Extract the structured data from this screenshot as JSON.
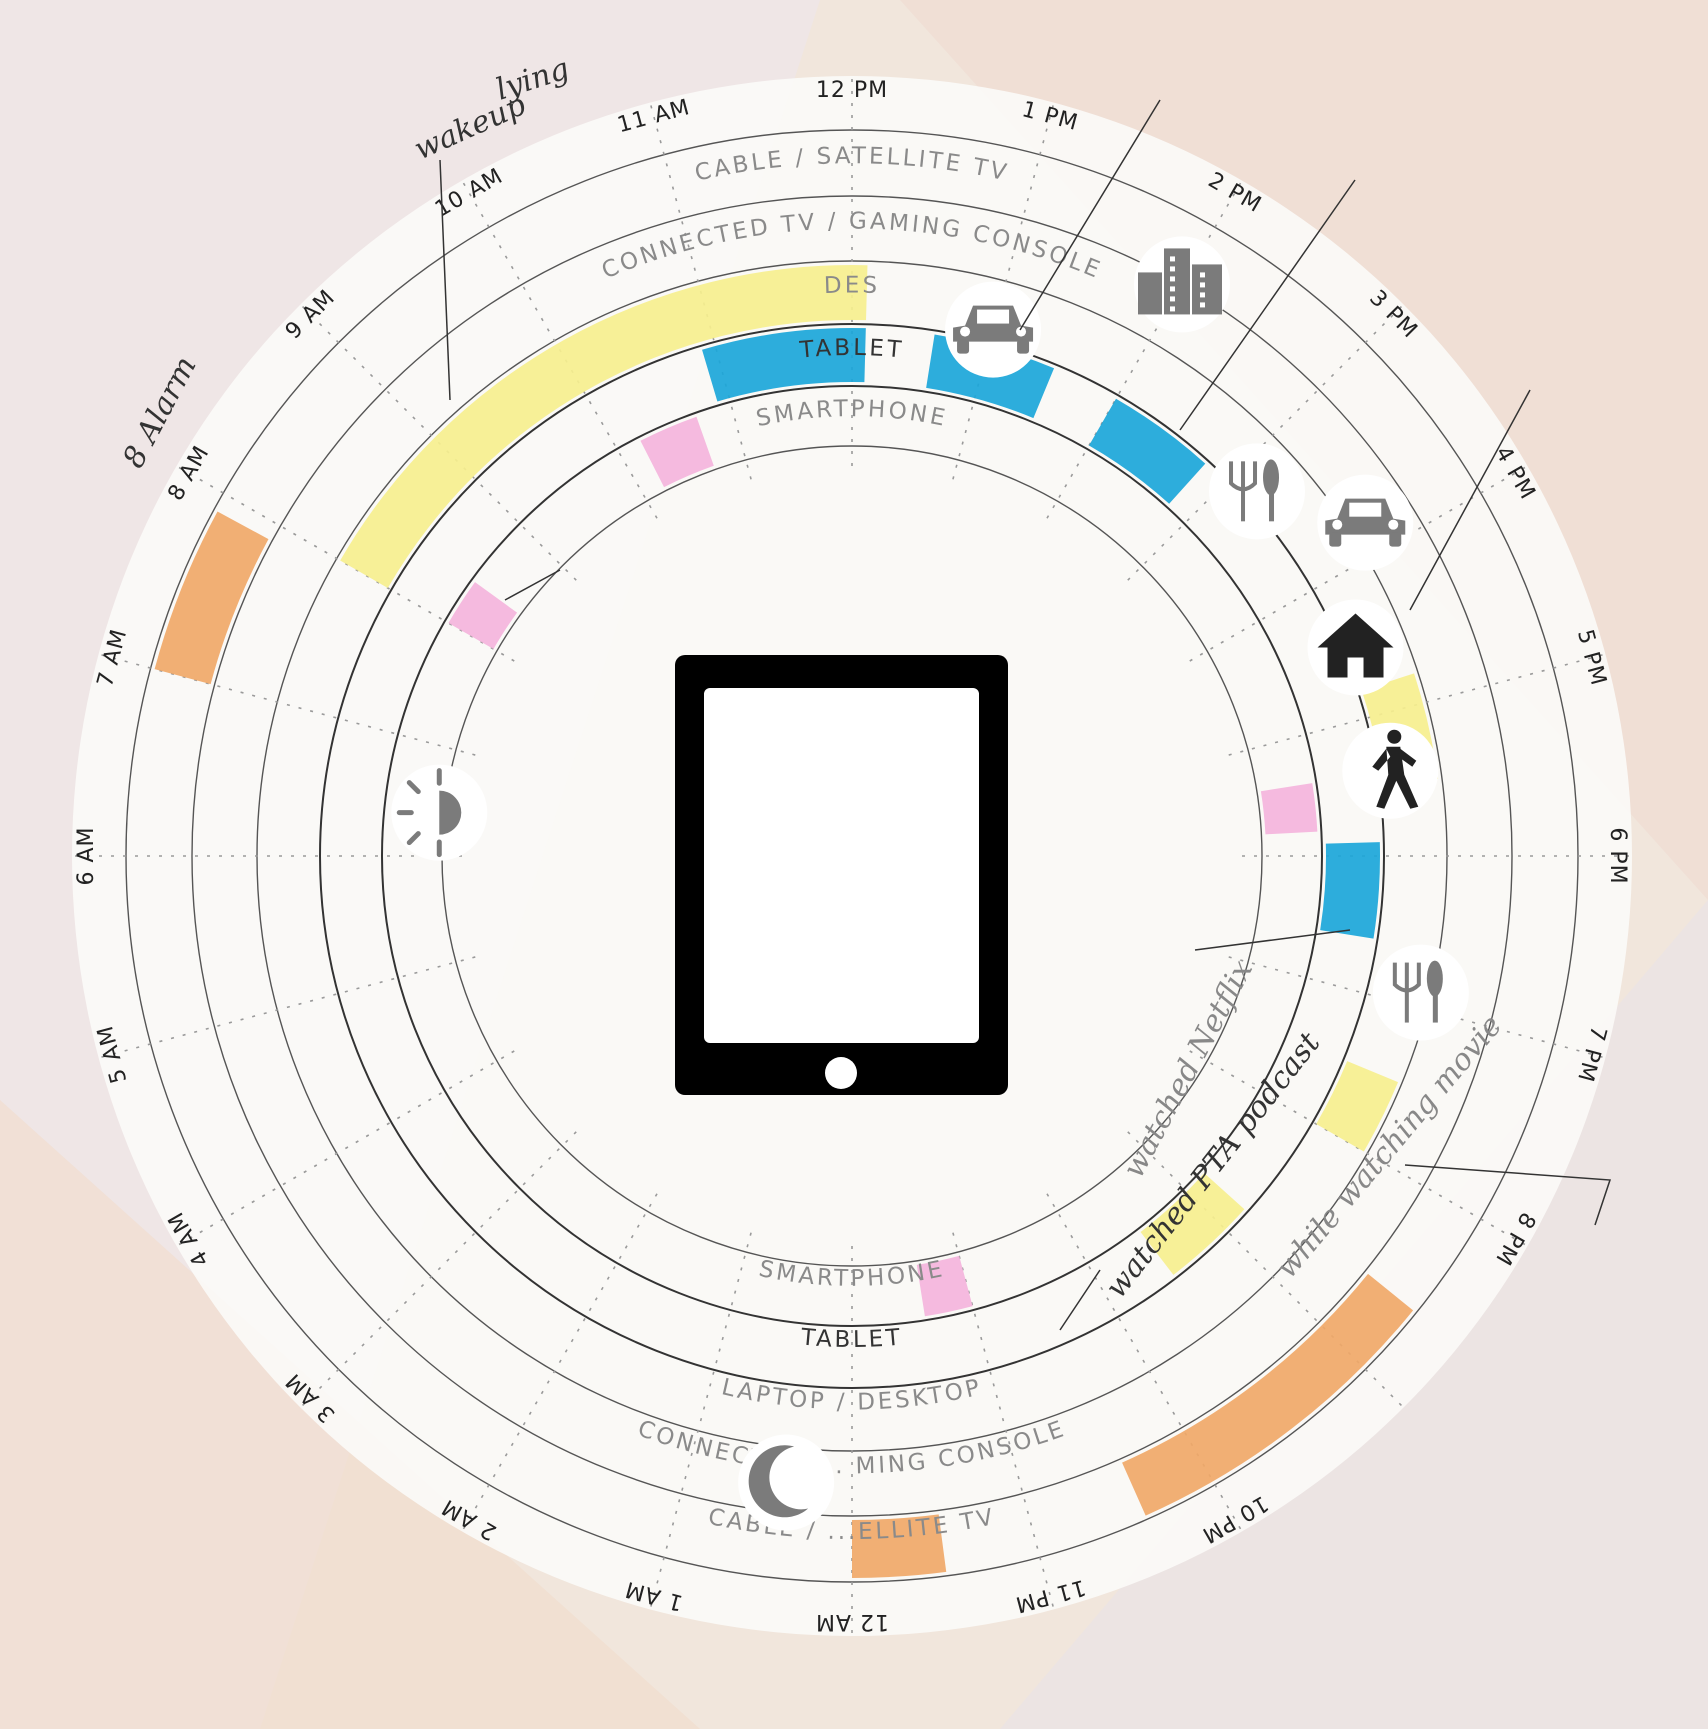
{
  "hour_labels": [
    {
      "text": "12 AM",
      "hour": 0
    },
    {
      "text": "1 AM",
      "hour": 1
    },
    {
      "text": "2 AM",
      "hour": 2
    },
    {
      "text": "3 AM",
      "hour": 3
    },
    {
      "text": "4 AM",
      "hour": 4
    },
    {
      "text": "5 AM",
      "hour": 5
    },
    {
      "text": "6 AM",
      "hour": 6
    },
    {
      "text": "7 AM",
      "hour": 7
    },
    {
      "text": "8 AM",
      "hour": 8
    },
    {
      "text": "9 AM",
      "hour": 9
    },
    {
      "text": "10 AM",
      "hour": 10
    },
    {
      "text": "11 AM",
      "hour": 11
    },
    {
      "text": "12 PM",
      "hour": 12
    },
    {
      "text": "1 PM",
      "hour": 13
    },
    {
      "text": "2 PM",
      "hour": 14
    },
    {
      "text": "3 PM",
      "hour": 15
    },
    {
      "text": "4 PM",
      "hour": 16
    },
    {
      "text": "5 PM",
      "hour": 17
    },
    {
      "text": "6 PM",
      "hour": 18
    },
    {
      "text": "7 PM",
      "hour": 19
    },
    {
      "text": "8 PM",
      "hour": 20
    },
    {
      "text": "10 PM",
      "hour": 22
    },
    {
      "text": "11 PM",
      "hour": 23
    }
  ],
  "rings": [
    {
      "name": "cable",
      "top_label": "CABLE / SATELLITE TV",
      "bottom_label": "CABLE / ...ELLITE TV"
    },
    {
      "name": "connected",
      "top_label": "CONNECTED TV / GAMING CONSOLE",
      "bottom_label": "CONNECTED ... MING CONSOLE"
    },
    {
      "name": "laptop",
      "top_label": "DES",
      "bottom_label": "LAPTOP / DESKTOP"
    },
    {
      "name": "tablet",
      "top_label": "TABLET",
      "bottom_label": "TABLET"
    },
    {
      "name": "smartphone",
      "top_label": "SMARTPHONE",
      "bottom_label": "SMARTPHONE"
    }
  ],
  "usage_segments": [
    {
      "ring": "cable",
      "start_hour": 7.0,
      "end_hour": 7.9,
      "color": "#f0a868"
    },
    {
      "ring": "cable",
      "start_hour": 20.6,
      "end_hour": 22.4,
      "color": "#f0a868"
    },
    {
      "ring": "cable",
      "start_hour": 23.5,
      "end_hour": 24.0,
      "color": "#f0a868"
    },
    {
      "ring": "laptop",
      "start_hour": 8.0,
      "end_hour": 12.1,
      "color": "#f6ef8e"
    },
    {
      "ring": "laptop",
      "start_hour": 16.8,
      "end_hour": 17.5,
      "color": "#f6ef8e"
    },
    {
      "ring": "laptop",
      "start_hour": 19.5,
      "end_hour": 20.0,
      "color": "#f6ef8e"
    },
    {
      "ring": "tablet",
      "start_hour": 10.9,
      "end_hour": 12.1,
      "color": "#1ba6d9"
    },
    {
      "ring": "tablet",
      "start_hour": 12.6,
      "end_hour": 13.5,
      "color": "#1ba6d9"
    },
    {
      "ring": "tablet",
      "start_hour": 14.0,
      "end_hour": 14.8,
      "color": "#1ba6d9"
    },
    {
      "ring": "tablet",
      "start_hour": 17.9,
      "end_hour": 18.6,
      "color": "#1ba6d9"
    },
    {
      "ring": "tablet",
      "start_hour": 20.8,
      "end_hour": 21.5,
      "color": "#f6ef8e"
    },
    {
      "ring": "smartphone",
      "start_hour": 8.0,
      "end_hour": 8.4,
      "color": "#f4b4dc"
    },
    {
      "ring": "smartphone",
      "start_hour": 10.2,
      "end_hour": 10.7,
      "color": "#f4b4dc"
    },
    {
      "ring": "smartphone",
      "start_hour": 17.4,
      "end_hour": 17.8,
      "color": "#f4b4dc"
    },
    {
      "ring": "smartphone",
      "start_hour": 23.0,
      "end_hour": 23.4,
      "color": "#f4b4dc"
    }
  ],
  "activity_icons": [
    {
      "icon": "car-icon",
      "hour": 13.0
    },
    {
      "icon": "office-building-icon",
      "hour": 14.0
    },
    {
      "icon": "fork-knife-icon",
      "hour": 15.2
    },
    {
      "icon": "car-icon",
      "hour": 15.8
    },
    {
      "icon": "house-icon",
      "hour": 16.5
    },
    {
      "icon": "walking-person-icon",
      "hour": 17.4
    },
    {
      "icon": "fork-knife-icon",
      "hour": 18.9
    },
    {
      "icon": "sunrise-icon",
      "hour": 6.4
    },
    {
      "icon": "moon-icon",
      "hour": 0.4
    }
  ],
  "handwritten_notes": [
    "wakeup",
    "lying",
    "8 Alarm",
    "watched Netflix",
    "watched PTA podcast",
    "while watching movie"
  ],
  "center_icon": "tablet-icon",
  "colors": {
    "blue": "#1ba6d9",
    "yellow": "#f6ef8e",
    "orange": "#f0a868",
    "pink": "#f4b4dc",
    "icon_gray": "#7b7b7b"
  }
}
